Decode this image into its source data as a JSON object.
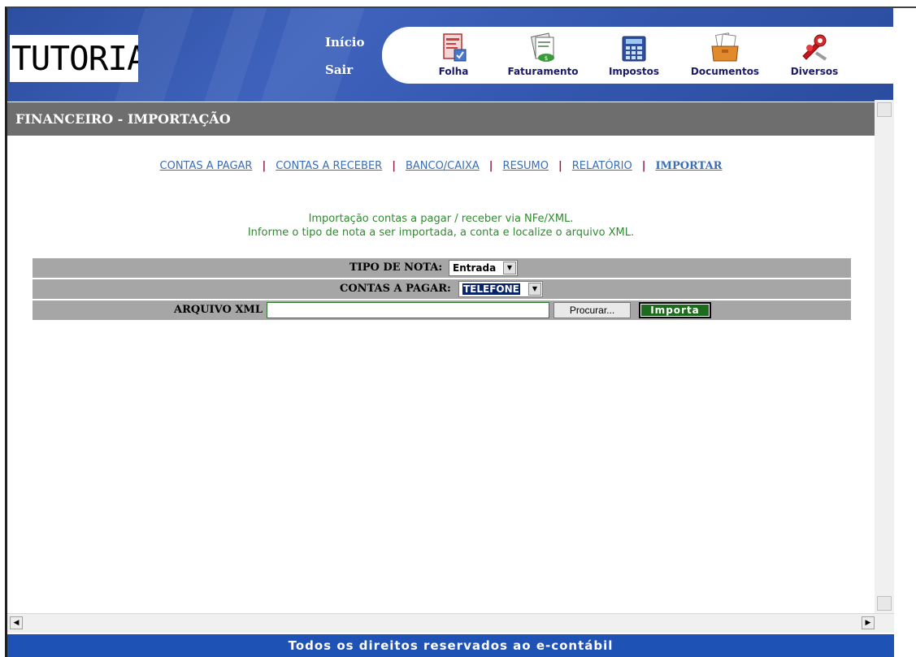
{
  "header": {
    "logo_text": "TUTORIAL",
    "nav": {
      "inicio": "Início",
      "sair": "Sair"
    },
    "modules": [
      {
        "label": "Folha",
        "icon": "payroll-icon"
      },
      {
        "label": "Faturamento",
        "icon": "billing-icon"
      },
      {
        "label": "Impostos",
        "icon": "calculator-icon"
      },
      {
        "label": "Documentos",
        "icon": "documents-icon"
      },
      {
        "label": "Diversos",
        "icon": "tools-icon"
      }
    ]
  },
  "page": {
    "title": "FINANCEIRO - IMPORTAÇÃO"
  },
  "subnav": {
    "items": [
      "CONTAS A PAGAR",
      "CONTAS A RECEBER",
      "BANCO/CAIXA",
      "RESUMO",
      "RELATÓRIO",
      "IMPORTAR"
    ],
    "separator": "|",
    "active": "IMPORTAR"
  },
  "instructions": {
    "line1": "Importação contas a pagar / receber via NFe/XML.",
    "line2": "Informe o tipo de nota a ser importada, a conta e localize o arquivo XML."
  },
  "form": {
    "tipo_label": "TIPO DE NOTA:",
    "tipo_value": "Entrada",
    "contas_label": "CONTAS A PAGAR:",
    "contas_value": "TELEFONE",
    "arquivo_label": "ARQUIVO XML",
    "arquivo_value": "",
    "browse_label": "Procurar...",
    "import_label": "Importa"
  },
  "footer": {
    "text": "Todos os direitos reservados ao e-contábil"
  },
  "colors": {
    "header_blue": "#3558b0",
    "title_bar": "#6e6e6e",
    "link_blue": "#3a6eb5",
    "separator": "#8b1a4a",
    "instruction_green": "#2e8b2e",
    "form_row": "#a6a6a6",
    "import_button": "#1d6b1d",
    "footer_blue": "#1f52b5"
  }
}
